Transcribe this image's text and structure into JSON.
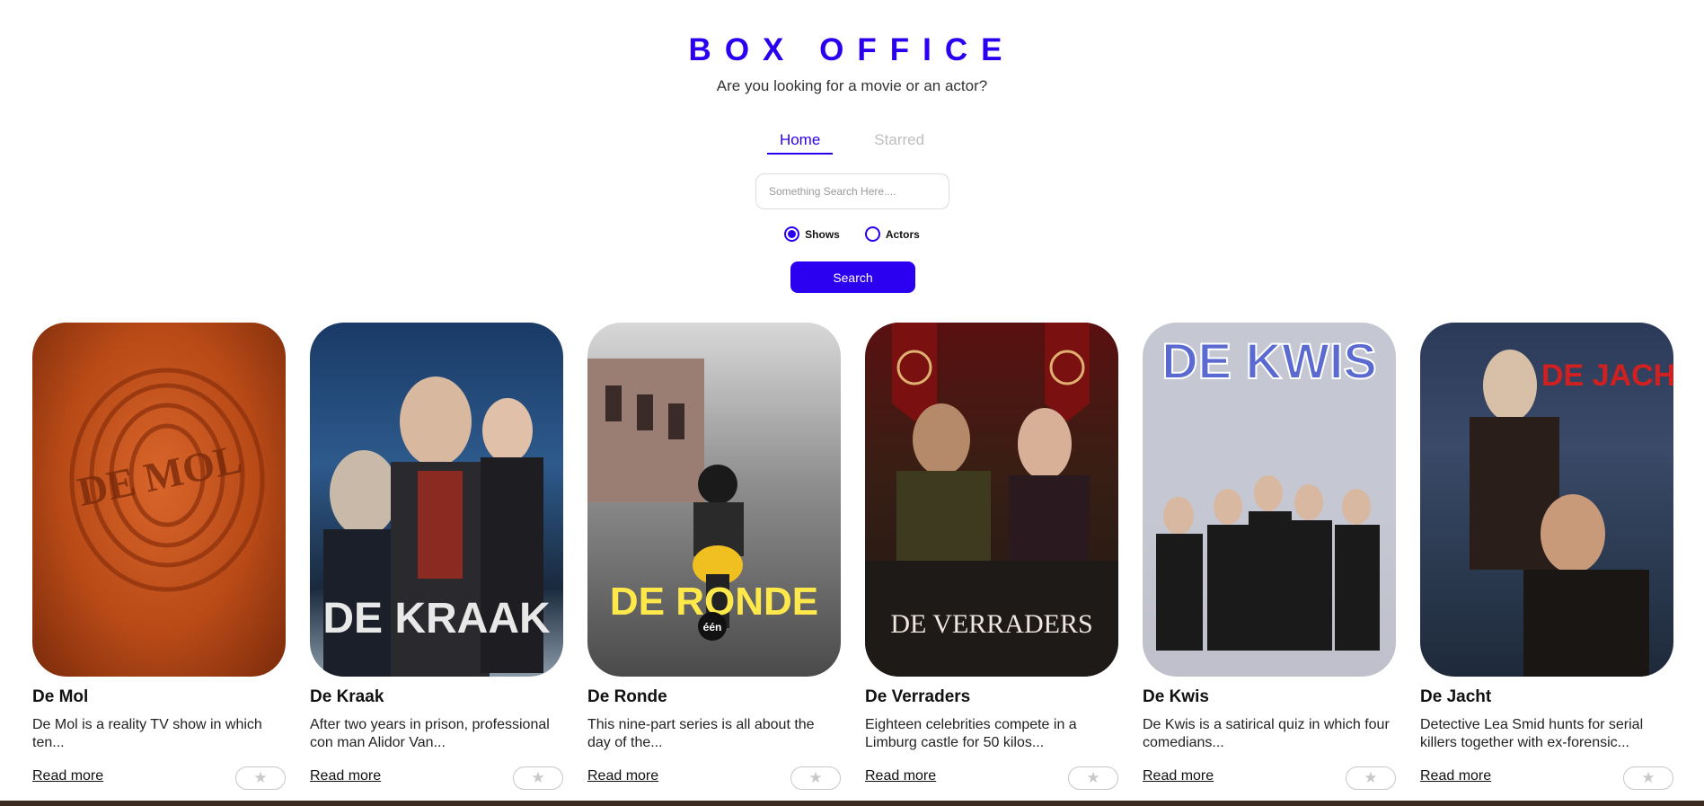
{
  "header": {
    "title": "BOX OFFICE",
    "subtitle": "Are you looking for a movie or an actor?"
  },
  "nav": {
    "tabs": [
      {
        "label": "Home",
        "active": true
      },
      {
        "label": "Starred",
        "active": false
      }
    ]
  },
  "search": {
    "placeholder": "Something Search Here....",
    "value": "",
    "options": [
      {
        "label": "Shows",
        "selected": true
      },
      {
        "label": "Actors",
        "selected": false
      }
    ],
    "button_label": "Search"
  },
  "colors": {
    "accent": "#2b00f0"
  },
  "cards": [
    {
      "title": "De Mol",
      "description": "De Mol is a reality TV show in which ten...",
      "read_more": "Read more",
      "star_icon": "star-icon",
      "poster_text": "DE MOL"
    },
    {
      "title": "De Kraak",
      "description": "After two years in prison, professional con man Alidor Van...",
      "read_more": "Read more",
      "star_icon": "star-icon",
      "poster_text": "DE KRAAK"
    },
    {
      "title": "De Ronde",
      "description": "This nine-part series is all about the day of the...",
      "read_more": "Read more",
      "star_icon": "star-icon",
      "poster_text": "DE RONDE"
    },
    {
      "title": "De Verraders",
      "description": "Eighteen celebrities compete in a Limburg castle for 50 kilos...",
      "read_more": "Read more",
      "star_icon": "star-icon",
      "poster_text": "DE VERRADERS"
    },
    {
      "title": "De Kwis",
      "description": "De Kwis is a satirical quiz in which four comedians...",
      "read_more": "Read more",
      "star_icon": "star-icon",
      "poster_text": "DE KWIS"
    },
    {
      "title": "De Jacht",
      "description": "Detective Lea Smid hunts for serial killers together with ex-forensic...",
      "read_more": "Read more",
      "star_icon": "star-icon",
      "poster_text": "DE JACHT"
    }
  ]
}
